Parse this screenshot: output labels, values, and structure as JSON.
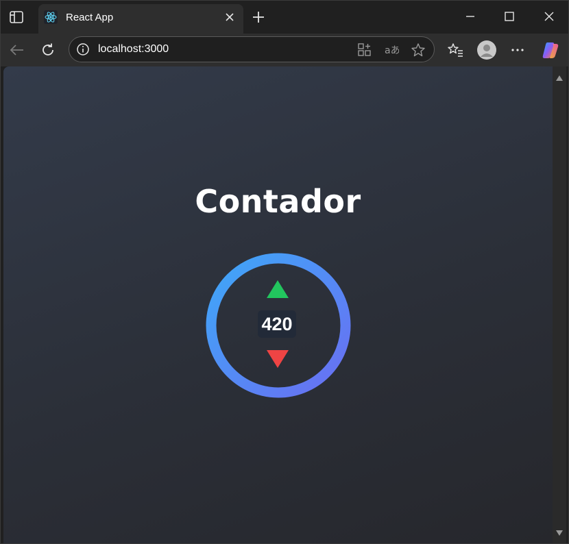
{
  "browser": {
    "tab": {
      "title": "React App",
      "favicon": "react-logo-icon"
    },
    "address_bar": {
      "url": "localhost:3000"
    },
    "icons": {
      "tab_strip": "tab-actions-icon",
      "new_tab": "plus-icon",
      "back": "back-arrow-icon",
      "refresh": "refresh-icon",
      "site_info": "info-icon",
      "apps": "apps-add-icon",
      "read_aloud": "translate-icon",
      "favorite": "star-icon",
      "favorites": "favorites-list-icon",
      "profile": "profile-avatar-icon",
      "more": "more-dots-icon",
      "copilot": "copilot-icon"
    }
  },
  "page": {
    "title": "Contador",
    "counter": {
      "value": "420",
      "increment_icon": "triangle-up-icon",
      "decrement_icon": "triangle-down-icon"
    }
  },
  "colors": {
    "ring_start": "#3ea8f8",
    "ring_end": "#6a6ef2",
    "increment": "#22c55e",
    "decrement": "#ef4444"
  }
}
